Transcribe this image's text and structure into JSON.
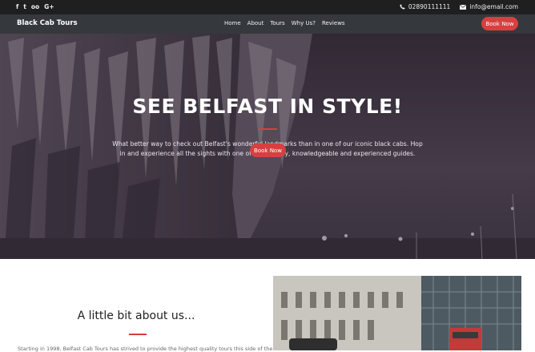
{
  "topbar": {
    "social_icons": [
      "facebook-icon",
      "twitter-icon",
      "tripadvisor-icon",
      "google-plus-icon"
    ],
    "social_glyphs": [
      "f",
      "t",
      "oo",
      "G+"
    ],
    "phone": "02890111111",
    "email": "info@email.com"
  },
  "nav": {
    "brand": "Black Cab Tours",
    "items": [
      {
        "label": "Home"
      },
      {
        "label": "About"
      },
      {
        "label": "Tours"
      },
      {
        "label": "Why Us?"
      },
      {
        "label": "Reviews"
      }
    ],
    "book_label": "Book Now"
  },
  "hero": {
    "title": "SEE BELFAST IN STYLE!",
    "text": "What better way to check out Belfast's wonderful landmarks than in one of our iconic black cabs. Hop in and experience all the sights with one of our friendly, knowledgeable and experienced guides.",
    "button_label": "Book Now"
  },
  "about": {
    "title": "A little bit about us...",
    "text": "Starting in 1998, Belfast Cab Tours has strived to provide the highest quality tours this side of the"
  },
  "colors": {
    "accent": "#d64040",
    "topbar": "#1f1f1f",
    "navbar": "#35383d"
  }
}
